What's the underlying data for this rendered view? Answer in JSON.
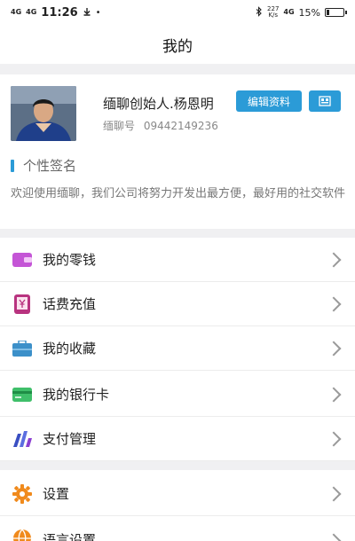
{
  "statusbar": {
    "signal1": "4G",
    "signal2": "4G",
    "time": "11:26",
    "speed_value": "227",
    "speed_unit": "K/s",
    "network": "4G",
    "battery": "15%",
    "battery_level": 0.15
  },
  "header": {
    "title": "我的"
  },
  "profile": {
    "nickname": "缅聊创始人.杨恩明",
    "edit_label": "编辑资料",
    "id_label": "缅聊号",
    "id_value": "09442149236"
  },
  "signature": {
    "title": "个性签名",
    "text": "欢迎使用缅聊，我们公司将努力开发出最方便，最好用的社交软件"
  },
  "menu": {
    "items": [
      {
        "label": "我的零钱",
        "icon": "wallet-icon"
      },
      {
        "label": "话费充值",
        "icon": "phone-recharge-icon"
      },
      {
        "label": "我的收藏",
        "icon": "favorites-icon"
      },
      {
        "label": "我的银行卡",
        "icon": "bank-card-icon"
      },
      {
        "label": "支付管理",
        "icon": "payment-management-icon"
      }
    ],
    "settings": [
      {
        "label": "设置",
        "icon": "settings-icon"
      },
      {
        "label": "语言设置",
        "icon": "language-icon"
      }
    ]
  },
  "colors": {
    "accent": "#2b9bd7",
    "section_gap": "#f0f0f2"
  }
}
